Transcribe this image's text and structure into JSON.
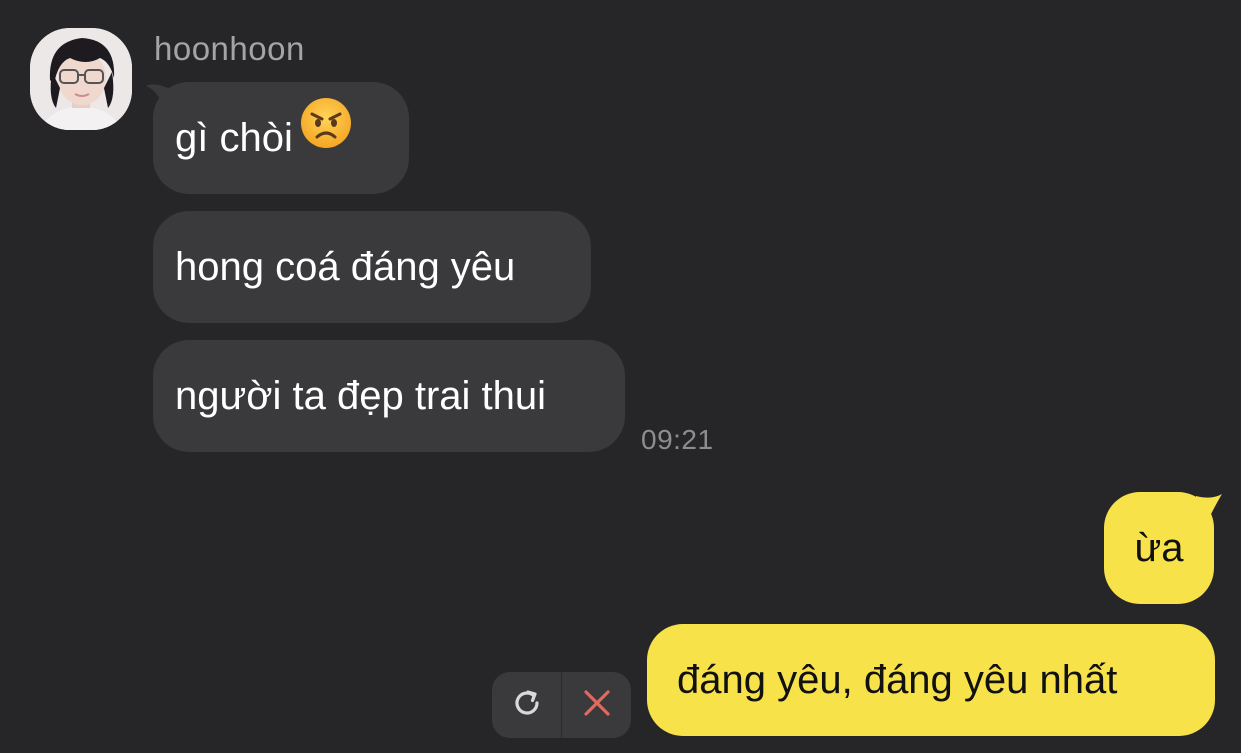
{
  "contact": {
    "name": "hoonhoon"
  },
  "incoming_messages": [
    {
      "text": "gì chòi",
      "emoji": "angry-face"
    },
    {
      "text": "hong coá đáng yêu"
    },
    {
      "text": "người ta đẹp trai thui"
    }
  ],
  "incoming_time": "09:21",
  "outgoing_messages": [
    {
      "text": "ừa",
      "status": "sent"
    },
    {
      "text": "đáng yêu, đáng yêu nhất",
      "status": "failed"
    }
  ],
  "failed_actions": {
    "retry_icon": "retry-icon",
    "delete_icon": "close-icon"
  },
  "colors": {
    "background": "#262628",
    "incoming_bubble": "#3a3a3c",
    "outgoing_bubble": "#f7e24a",
    "delete_red": "#e06a60"
  }
}
